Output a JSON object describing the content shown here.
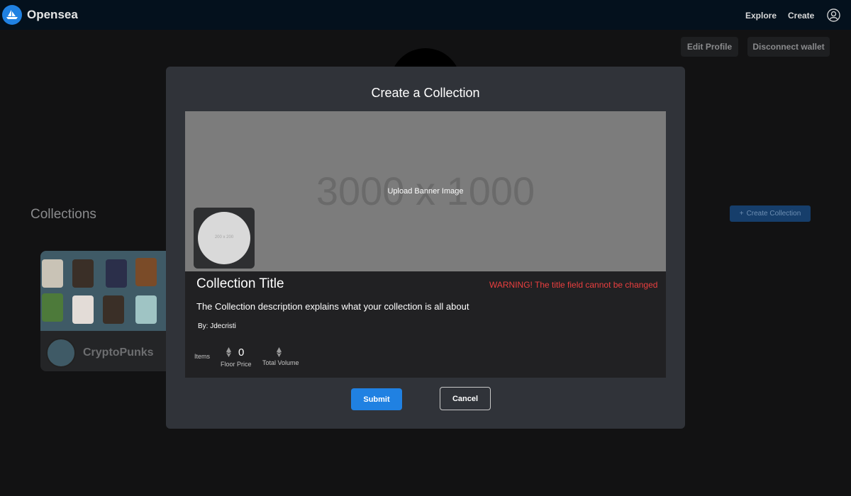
{
  "nav": {
    "brand": "Opensea",
    "explore_label": "Explore",
    "create_label": "Create"
  },
  "profile_page": {
    "edit_profile_label": "Edit Profile",
    "disconnect_label": "Disconnect wallet",
    "collections_heading": "Collections",
    "create_collection_label": "Create Collection",
    "cards": [
      {
        "name": "CryptoPunks"
      }
    ]
  },
  "modal": {
    "title": "Create a Collection",
    "banner_placeholder": "3000 x 1000",
    "banner_upload_label": "Upload Banner Image",
    "logo_placeholder": "200 x 200",
    "collection_title": "Collection Title",
    "warning": "WARNING! The title field cannot be changed",
    "description": "The Collection description explains what your collection is all about",
    "byline": "By: Jdecristi",
    "stats": {
      "items_label": "Items",
      "floor_price_value": "0",
      "floor_price_label": "Floor Price",
      "total_volume_label": "Total Volume"
    },
    "submit_label": "Submit",
    "cancel_label": "Cancel"
  },
  "colors": {
    "nav_bg": "#04111d",
    "page_bg": "#121213",
    "modal_bg": "#303339",
    "accent": "#2081e2",
    "warning": "#eb3f3f"
  }
}
